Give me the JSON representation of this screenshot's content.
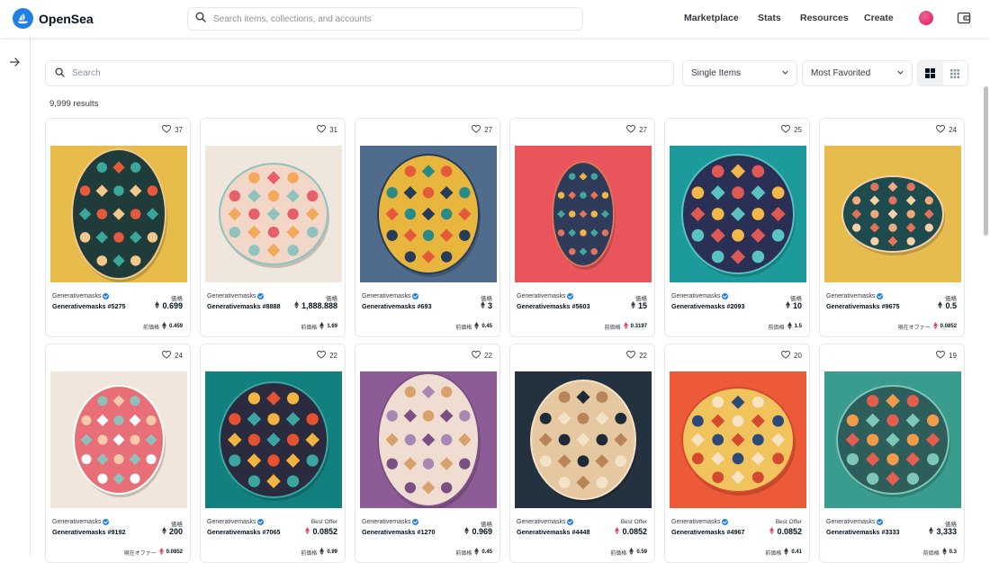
{
  "header": {
    "brand": "OpenSea",
    "search_placeholder": "Search items, collections, and accounts",
    "nav": [
      "Marketplace",
      "Stats",
      "Resources",
      "Create"
    ]
  },
  "filters": {
    "search_placeholder": "Search",
    "item_type": "Single Items",
    "sort": "Most Favorited"
  },
  "results_text": "9,999 results",
  "colors": {
    "accent": "#2081e2",
    "text": "#04111d",
    "border": "#e5e8eb"
  },
  "cards": [
    {
      "likes": "37",
      "collection": "Generativemasks",
      "name": "Generativemasks #5275",
      "price_label": "価格",
      "price": "0.699",
      "footer_label": "前価格",
      "footer_value": "0.459",
      "footer_currency": "eth",
      "bg": "#e7bc4a",
      "mask": "#1f3b3a",
      "p1": "#e65a3b",
      "p2": "#3aa79a",
      "p3": "#f0c98b"
    },
    {
      "likes": "31",
      "collection": "Generativemasks",
      "name": "Generativemasks #8888",
      "price_label": "価格",
      "price": "1,888.888",
      "footer_label": "前価格",
      "footer_value": "1.69",
      "footer_currency": "eth",
      "bg": "#efe6dc",
      "mask": "#f2d7c9",
      "p1": "#e85f6a",
      "p2": "#f4a85a",
      "p3": "#8fc3c0"
    },
    {
      "likes": "27",
      "collection": "Generativemasks",
      "name": "Generativemasks #693",
      "price_label": "価格",
      "price": "3",
      "footer_label": "前価格",
      "footer_value": "0.45",
      "footer_currency": "eth",
      "bg": "#4f6c8c",
      "mask": "#e8b63d",
      "p1": "#2a8a86",
      "p2": "#e45a3b",
      "p3": "#263b58"
    },
    {
      "likes": "27",
      "collection": "Generativemasks",
      "name": "Generativemasks #5603",
      "price_label": "価格",
      "price": "15",
      "footer_label": "前価格",
      "footer_value": "0.3197",
      "footer_currency": "weth",
      "bg": "#e9555a",
      "mask": "#2e3c5a",
      "p1": "#f1b54a",
      "p2": "#3fa69e",
      "p3": "#e3745a"
    },
    {
      "likes": "25",
      "collection": "Generativemasks",
      "name": "Generativemasks #2093",
      "price_label": "価格",
      "price": "10",
      "footer_label": "前価格",
      "footer_value": "1.5",
      "footer_currency": "eth",
      "bg": "#1d9b9c",
      "mask": "#2a2f56",
      "p1": "#f3b74a",
      "p2": "#e05a55",
      "p3": "#5ac2c0"
    },
    {
      "likes": "24",
      "collection": "Generativemasks",
      "name": "Generativemasks #9675",
      "price_label": "価格",
      "price": "0.5",
      "footer_label": "現在オファー",
      "footer_value": "0.0852",
      "footer_currency": "weth",
      "bg": "#e7bc4f",
      "mask": "#1e4b4e",
      "p1": "#f2a97b",
      "p2": "#e2725a",
      "p3": "#f5d0a8"
    },
    {
      "likes": "24",
      "collection": "Generativemasks",
      "name": "Generativemasks #9192",
      "price_label": "価格",
      "price": "200",
      "footer_label": "現在オファー",
      "footer_value": "0.0852",
      "footer_currency": "weth",
      "bg": "#f1e6dc",
      "mask": "#e86f78",
      "p1": "#f6c9a9",
      "p2": "#8fc1bc",
      "p3": "#ffffff"
    },
    {
      "likes": "22",
      "collection": "Generativemasks",
      "name": "Generativemasks #7065",
      "price_label": "Best Offer",
      "price": "0.0852",
      "footer_label": "前価格",
      "footer_value": "0.99",
      "footer_currency": "eth",
      "bg": "#12807f",
      "mask": "#2b2b3f",
      "p1": "#e6522f",
      "p2": "#f1b53f",
      "p3": "#3ba6a1"
    },
    {
      "likes": "22",
      "collection": "Generativemasks",
      "name": "Generativemasks #1270",
      "price_label": "価格",
      "price": "0.969",
      "footer_label": "前価格",
      "footer_value": "0.45",
      "footer_currency": "eth",
      "bg": "#8d5c97",
      "mask": "#f0ddd2",
      "p1": "#a887b4",
      "p2": "#d8a06a",
      "p3": "#7c4f84"
    },
    {
      "likes": "22",
      "collection": "Generativemasks",
      "name": "Generativemasks #4448",
      "price_label": "Best Offer",
      "price": "0.0852",
      "footer_label": "前価格",
      "footer_value": "0.59",
      "footer_currency": "eth",
      "bg": "#24313f",
      "mask": "#e5c89f",
      "p1": "#1d2a3a",
      "p2": "#b9845a",
      "p3": "#f2e2c8"
    },
    {
      "likes": "20",
      "collection": "Generativemasks",
      "name": "Generativemasks #4967",
      "price_label": "Best Offer",
      "price": "0.0852",
      "footer_label": "前価格",
      "footer_value": "0.41",
      "footer_currency": "eth",
      "bg": "#ed5a37",
      "mask": "#f1c35c",
      "p1": "#2b4a7a",
      "p2": "#f6e4c2",
      "p3": "#d4492f"
    },
    {
      "likes": "19",
      "collection": "Generativemasks",
      "name": "Generativemasks #3333",
      "price_label": "価格",
      "price": "3,333",
      "footer_label": "前価格",
      "footer_value": "0.3",
      "footer_currency": "eth",
      "bg": "#3a9c8e",
      "mask": "#2e5e5c",
      "p1": "#f09a4a",
      "p2": "#e35e4f",
      "p3": "#7cc7b7"
    }
  ]
}
